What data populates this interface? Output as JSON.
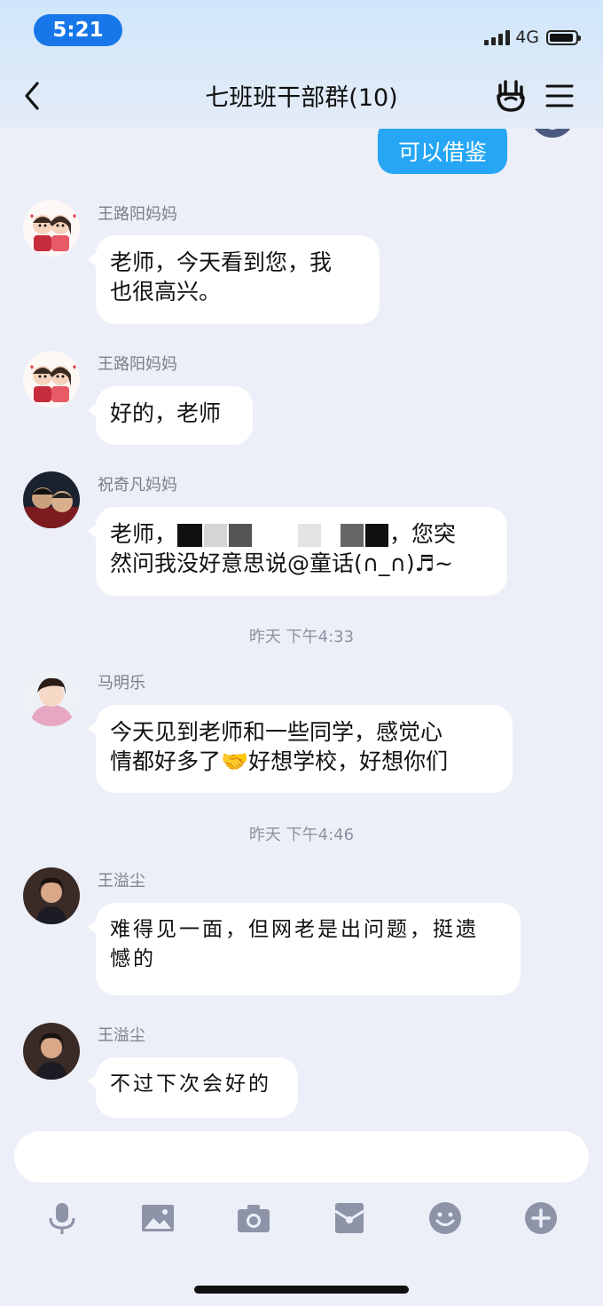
{
  "status": {
    "time": "5:21",
    "network": "4G"
  },
  "header": {
    "title": "七班班干部群(10)"
  },
  "outgoing": {
    "text": "可以借鉴"
  },
  "messages": [
    {
      "sender": "王路阳妈妈",
      "lines": [
        "老师，今天看到您，我",
        "也很高兴。"
      ]
    },
    {
      "sender": "王路阳妈妈",
      "lines": [
        "好的，老师"
      ]
    },
    {
      "sender": "祝奇凡妈妈",
      "line1_start": "老师，",
      "line1_end": "，您突",
      "line2": "然问我没好意思说@童话(∩_∩)♬~"
    },
    {
      "sender": "马明乐",
      "line1": "今天见到老师和一些同学，感觉心",
      "line2_start": "情都好多了",
      "line2_emoji": "🤝",
      "line2_end": "好想学校，好想你们"
    },
    {
      "sender": "王溢尘",
      "lines": [
        "难得见一面，但网老是出问题，挺遗",
        "憾的"
      ]
    },
    {
      "sender": "王溢尘",
      "lines": [
        "不过下次会好的"
      ]
    }
  ],
  "timestamps": [
    "昨天 下午4:33",
    "昨天 下午4:46"
  ],
  "input": {
    "placeholder": ""
  },
  "toolbar": [
    "microphone-icon",
    "image-icon",
    "camera-icon",
    "red-packet-icon",
    "emoji-icon",
    "plus-icon"
  ],
  "colors": {
    "accent": "#1877e8",
    "outgoing_bubble": "#26a6f4",
    "background": "#eceff8",
    "tool_icon": "#8e94a8"
  }
}
